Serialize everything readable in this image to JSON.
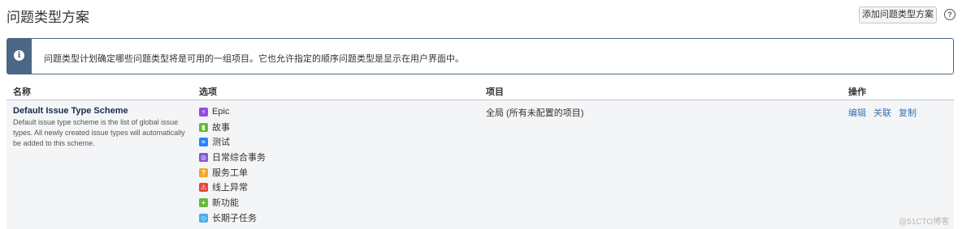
{
  "page": {
    "title": "问题类型方案",
    "add_button": "添加问题类型方案",
    "help_icon_glyph": "?"
  },
  "info": {
    "icon_glyph": "i",
    "text": "问题类型计划确定哪些问题类型将是可用的一组项目。它也允许指定的顺序问题类型是显示在用户界面中。"
  },
  "table": {
    "headers": {
      "name": "名称",
      "options": "选项",
      "project": "项目",
      "actions": "操作"
    },
    "row": {
      "name": "Default Issue Type Scheme",
      "description": "Default issue type scheme is the list of global issue types. All newly created issue types will automatically be added to this scheme.",
      "project": "全局 (所有未配置的项目)",
      "options": [
        {
          "label": "Epic",
          "icon": "epic-icon",
          "color": "#904ee2",
          "glyph": "⚡"
        },
        {
          "label": "故事",
          "icon": "story-icon",
          "color": "#63ba3c",
          "glyph": "▮"
        },
        {
          "label": "测试",
          "icon": "test-icon",
          "color": "#2684ff",
          "glyph": "≈"
        },
        {
          "label": "日常综合事务",
          "icon": "daily-affairs-icon",
          "color": "#8155d3",
          "glyph": "◎"
        },
        {
          "label": "服务工单",
          "icon": "service-ticket-icon",
          "color": "#f5a623",
          "glyph": "?"
        },
        {
          "label": "线上异常",
          "icon": "online-exception-icon",
          "color": "#e5493a",
          "glyph": "⚠"
        },
        {
          "label": "新功能",
          "icon": "new-feature-icon",
          "color": "#63ba3c",
          "glyph": "+"
        },
        {
          "label": "长期子任务",
          "icon": "long-subtask-icon",
          "color": "#4bade8",
          "glyph": "◇"
        }
      ],
      "actions": [
        "编辑",
        "关联",
        "复制"
      ]
    }
  },
  "watermark": "@51CTO博客"
}
